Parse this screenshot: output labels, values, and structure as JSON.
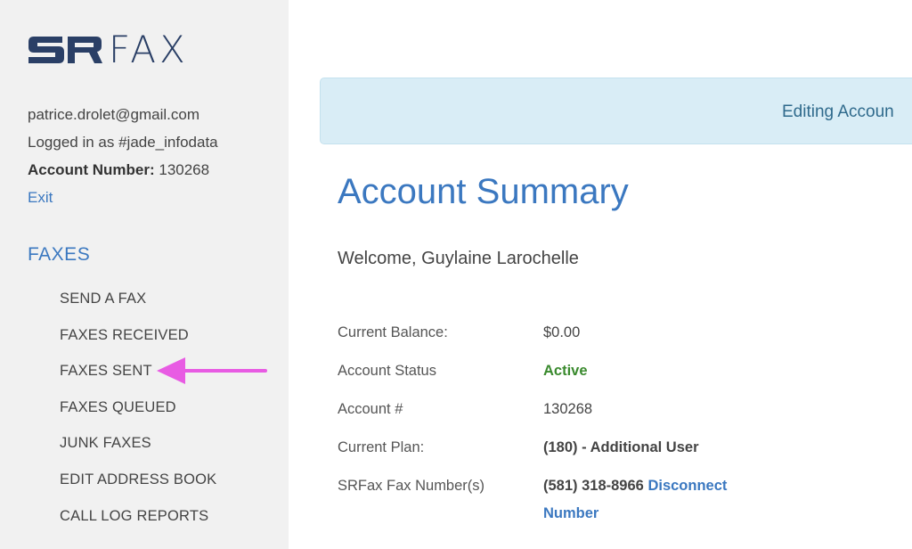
{
  "brand": {
    "logo_text": "FAX",
    "logo_color": "#2a3f66"
  },
  "account_info": {
    "email": "patrice.drolet@gmail.com",
    "logged_in_as": "Logged in as #jade_infodata",
    "account_number_label": "Account Number:",
    "account_number_value": "130268",
    "exit_label": "Exit"
  },
  "sidebar": {
    "section_title": "FAXES",
    "items": [
      {
        "label": "SEND A FAX"
      },
      {
        "label": "FAXES RECEIVED"
      },
      {
        "label": "FAXES SENT"
      },
      {
        "label": "FAXES QUEUED"
      },
      {
        "label": "JUNK FAXES"
      },
      {
        "label": "EDIT ADDRESS BOOK"
      },
      {
        "label": "CALL LOG REPORTS"
      }
    ],
    "annotation_arrow_color": "#e85be3"
  },
  "banner": {
    "text": "Editing Accoun"
  },
  "main": {
    "title": "Account Summary",
    "welcome": "Welcome, Guylaine Larochelle",
    "summary": {
      "balance_label": "Current Balance:",
      "balance_value": "$0.00",
      "status_label": "Account Status",
      "status_value": "Active",
      "account_label": "Account #",
      "account_value": "130268",
      "plan_label": "Current Plan:",
      "plan_value": "(180) - Additional User",
      "fax_numbers_label": "SRFax Fax Number(s)",
      "fax_number_value": "(581) 318-8966",
      "disconnect_word1": "Disconnect",
      "disconnect_word2": "Number"
    }
  },
  "colors": {
    "sidebar_bg": "#f1f1f1",
    "link_blue": "#3b78c0",
    "banner_bg": "#d9edf6",
    "active_green": "#3a8a2e"
  }
}
